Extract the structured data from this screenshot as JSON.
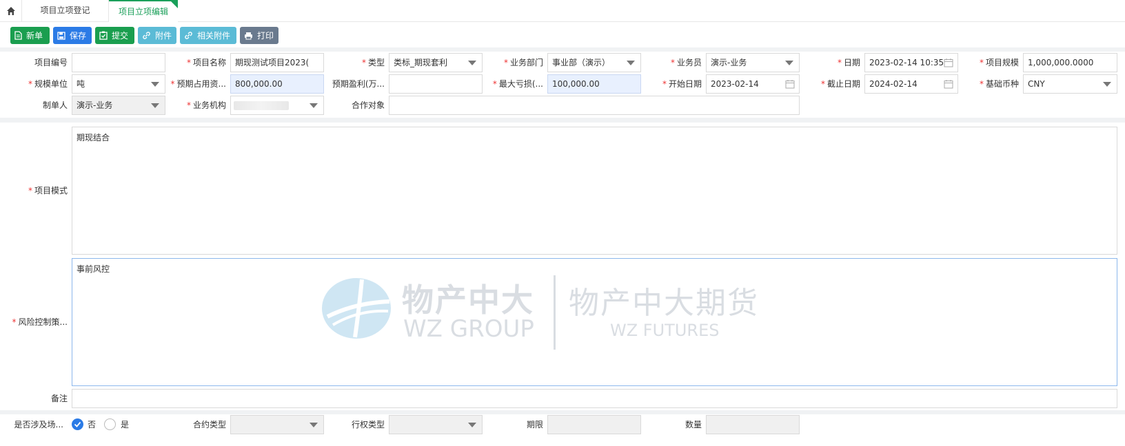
{
  "tabs": [
    {
      "label": "项目立项登记"
    },
    {
      "label": "项目立项编辑"
    }
  ],
  "toolbar": {
    "new_label": "新单",
    "save_label": "保存",
    "submit_label": "提交",
    "attach_label": "附件",
    "related_attach_label": "相关附件",
    "print_label": "打印"
  },
  "form": {
    "project_no": {
      "label": "项目编号",
      "value": ""
    },
    "project_name": {
      "label": "项目名称",
      "value": "期现测试项目2023("
    },
    "type": {
      "label": "类型",
      "value": "类标_期现套利"
    },
    "department": {
      "label": "业务部门",
      "value": "事业部（演示）"
    },
    "salesman": {
      "label": "业务员",
      "value": "演示-业务"
    },
    "date": {
      "label": "日期",
      "value": "2023-02-14 10:35"
    },
    "project_scale": {
      "label": "项目规模",
      "value": "1,000,000.0000"
    },
    "scale_unit": {
      "label": "规模单位",
      "value": "吨"
    },
    "expected_capital": {
      "label": "预期占用资...",
      "value": "800,000.00"
    },
    "expected_profit": {
      "label": "预期盈利(万...",
      "value": ""
    },
    "max_loss": {
      "label": "最大亏损(...",
      "value": "100,000.00"
    },
    "start_date": {
      "label": "开始日期",
      "value": "2023-02-14"
    },
    "end_date": {
      "label": "截止日期",
      "value": "2024-02-14"
    },
    "base_currency": {
      "label": "基础币种",
      "value": "CNY"
    },
    "creator": {
      "label": "制单人",
      "value": "演示-业务"
    },
    "business_org": {
      "label": "业务机构",
      "value": ""
    },
    "partner": {
      "label": "合作对象",
      "value": ""
    },
    "project_mode": {
      "label": "项目模式",
      "value": "期现结合"
    },
    "risk_strategy": {
      "label": "风险控制策...",
      "value": "事前风控"
    },
    "remark": {
      "label": "备注",
      "value": ""
    },
    "involves_exchange": {
      "label": "是否涉及场...",
      "option_no": "否",
      "option_yes": "是"
    },
    "contract_type": {
      "label": "合约类型",
      "value": ""
    },
    "exercise_type": {
      "label": "行权类型",
      "value": ""
    },
    "term": {
      "label": "期限",
      "value": ""
    },
    "quantity": {
      "label": "数量",
      "value": ""
    }
  },
  "watermark": {
    "cn_name": "物产中大",
    "en_name": "WZ GROUP",
    "cn_sub": "物产中大期货",
    "en_sub": "WZ FUTURES"
  },
  "colors": {
    "green": "#1a9e4f",
    "blue": "#2b7be6",
    "cyan": "#5bbbd6",
    "slate": "#6a7a8e",
    "required": "#e33333"
  }
}
